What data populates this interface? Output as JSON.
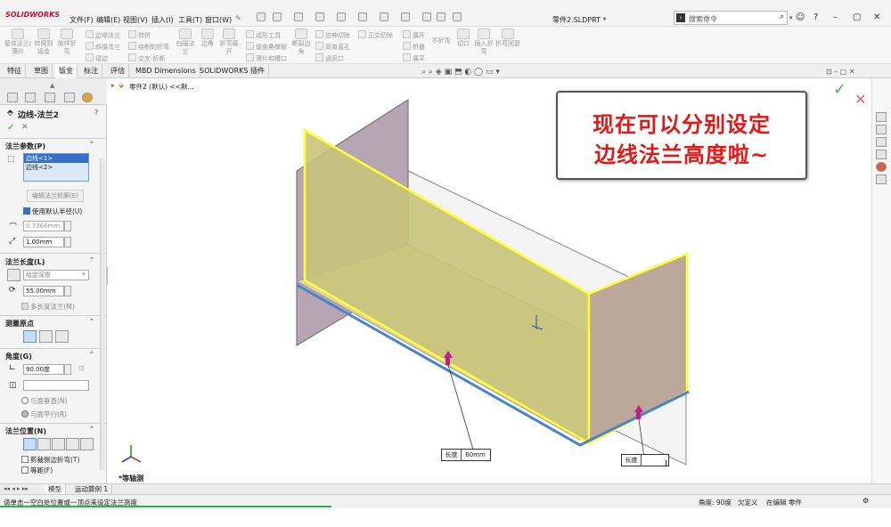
{
  "app": {
    "logo": "SOLIDWORKS",
    "doc_title": "零件2.SLDPRT *"
  },
  "menu": [
    "文件(F)",
    "编辑(E)",
    "视图(V)",
    "插入(I)",
    "工具(T)",
    "窗口(W)"
  ],
  "search": {
    "placeholder": "搜索命令"
  },
  "ribbon": {
    "big": [
      "基体法兰/薄片",
      "转换到钣金",
      "放样折弯",
      "扫描法兰",
      "边角",
      "折弯展开",
      "断裂边角",
      "切口",
      "插入折弯",
      "折弯回复"
    ],
    "small": [
      "边缘法兰",
      "斜接法兰",
      "褶边",
      "转折",
      "绘制的折弯",
      "交叉-折断",
      "成形工具",
      "钣金角撑板",
      "薄片和槽口",
      "拉伸切除",
      "简单直孔",
      "通风口",
      "正交切除",
      "展开",
      "折叠",
      "展平",
      "不折弯"
    ]
  },
  "tabs": [
    "特征",
    "草图",
    "钣金",
    "标注",
    "评估",
    "MBD Dimensions",
    "SOLIDWORKS 插件"
  ],
  "tree": {
    "item": "零件2 (默认) <<默..."
  },
  "panel": {
    "title": "边线-法兰2",
    "params_section": "法兰参数(P)",
    "edges": [
      "边线<1>",
      "边线<2>"
    ],
    "edit_profile": "编辑法兰轮廓(E)",
    "use_default_radius": "使用默认半径(U)",
    "radius": "0.7366mm",
    "gap": "1.00mm",
    "length_section": "法兰长度(L)",
    "end_condition": "给定深度",
    "length": "55.00mm",
    "multi_length": "多长度法兰(M)",
    "measure_section": "测量原点",
    "angle_section": "角度(G)",
    "angle": "90.00度",
    "face_perpendicular": "与面垂直(N)",
    "face_parallel": "与面平行(R)",
    "position_section": "法兰位置(N)",
    "trim_side_bends": "剪裁侧边折弯(T)",
    "offset": "等距(F)"
  },
  "callout": {
    "line1": "现在可以分别设定",
    "line2": "边线法兰高度啦~"
  },
  "dims": {
    "label": "长度",
    "value1": "60mm"
  },
  "view_label": "*等轴测",
  "bottom_tabs": [
    "模型",
    "运动算例 1"
  ],
  "status": {
    "hint": "请单击一空白处位置或一顶点来设定法兰高度",
    "angle": "角度: 90度",
    "defined": "欠定义",
    "editing": "在编辑 零件"
  },
  "colors": {
    "flange_fill": "#c8c47a",
    "edge_yellow": "#ffff33",
    "bottom_edge": "#4a84c8",
    "callout_red": "#e01818",
    "handle": "#c0208a"
  }
}
